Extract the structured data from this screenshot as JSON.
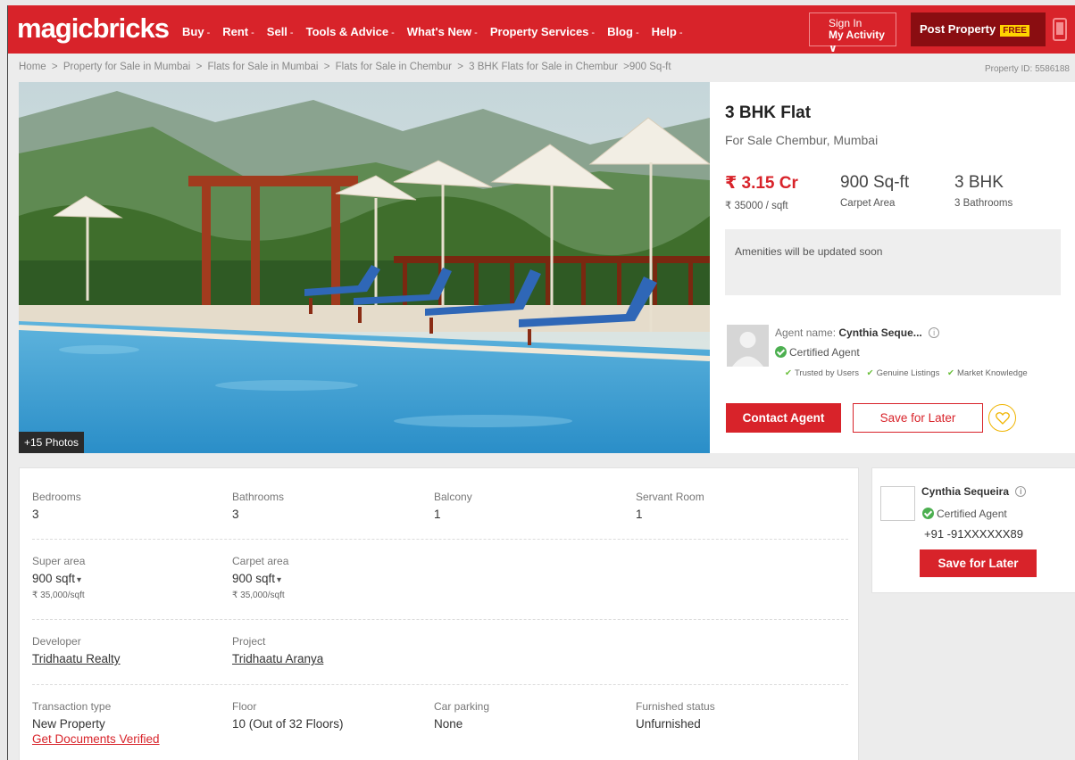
{
  "header": {
    "logo": "magicbricks",
    "nav": [
      {
        "label": "Buy",
        "caret": "-"
      },
      {
        "label": "Rent",
        "caret": "-"
      },
      {
        "label": "Sell",
        "caret": "-"
      },
      {
        "label": "Tools & Advice",
        "caret": "-"
      },
      {
        "label": "What's New",
        "caret": "-"
      },
      {
        "label": "Property Services",
        "caret": "-"
      },
      {
        "label": "Blog",
        "caret": "-"
      },
      {
        "label": "Help",
        "caret": "-"
      }
    ],
    "signin_line1": "Sign In",
    "signin_line2": "My Activity ∨",
    "post_label": "Post Property",
    "free_badge": "FREE"
  },
  "breadcrumb": {
    "items": [
      "Home",
      "Property for Sale in Mumbai",
      "Flats for Sale in Mumbai",
      "Flats for Sale in Chembur",
      "3 BHK Flats for Sale in Chembur",
      "900 Sq-ft"
    ],
    "separator": ">",
    "property_id": "Property ID: 5586188"
  },
  "gallery": {
    "photo_count": "+15 Photos"
  },
  "summary": {
    "title": "3 BHK Flat",
    "locality": "For Sale Chembur, Mumbai",
    "price": "₹ 3.15 Cr",
    "price_per_sqft": "₹ 35000 / sqft",
    "area": "900 Sq-ft",
    "area_label": "Carpet Area",
    "bhk": "3 BHK",
    "bathrooms": "3 Bathrooms",
    "amenities_text": "Amenities will be updated soon",
    "agent_label": "Agent name:",
    "agent_name": "Cynthia Seque...",
    "certified": "Certified Agent",
    "trust": [
      "Trusted by Users",
      "Genuine Listings",
      "Market Knowledge"
    ],
    "contact_btn": "Contact Agent",
    "save_btn": "Save for Later"
  },
  "details": {
    "row1": [
      {
        "label": "Bedrooms",
        "value": "3"
      },
      {
        "label": "Bathrooms",
        "value": "3"
      },
      {
        "label": "Balcony",
        "value": "1"
      },
      {
        "label": "Servant Room",
        "value": "1"
      }
    ],
    "row2": [
      {
        "label": "Super area",
        "value": "900 sqft",
        "sub": "₹ 35,000/sqft"
      },
      {
        "label": "Carpet area",
        "value": "900 sqft",
        "sub": "₹ 35,000/sqft"
      }
    ],
    "row3": [
      {
        "label": "Developer",
        "value": "Tridhaatu Realty"
      },
      {
        "label": "Project",
        "value": "Tridhaatu Aranya"
      }
    ],
    "row4": [
      {
        "label": "Transaction type",
        "value": "New Property",
        "link": "Get Documents Verified"
      },
      {
        "label": "Floor",
        "value": "10 (Out of 32 Floors)"
      },
      {
        "label": "Car parking",
        "value": "None"
      },
      {
        "label": "Furnished status",
        "value": "Unfurnished"
      }
    ]
  },
  "agent_card": {
    "name": "Cynthia Sequeira",
    "certified": "Certified Agent",
    "phone": "+91 -91XXXXXX89",
    "save_btn": "Save for Later"
  },
  "colors": {
    "brand_red": "#d8232a",
    "dark_red": "#8a0d11",
    "free_yellow": "#ffd400",
    "certified_green": "#4caf50"
  }
}
